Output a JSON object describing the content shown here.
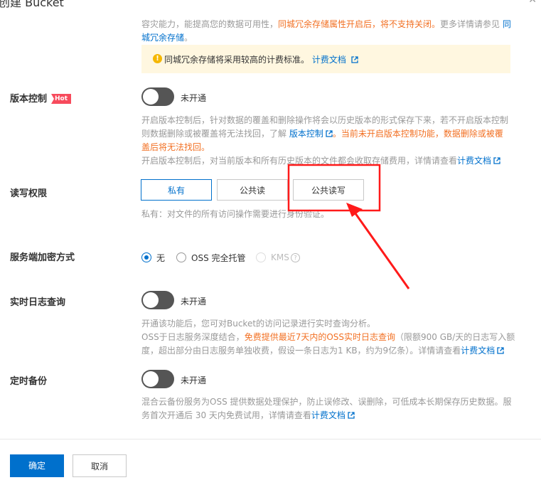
{
  "dialog": {
    "title": "创建 Bucket",
    "close_icon": "close-icon"
  },
  "redundancy": {
    "desc_line1_gray": "容灾能力，能提高您的数据可用性，",
    "desc_line1_orange": "同城冗余存储属性开启后，将不支持关闭。",
    "desc_line1_gray2": "更多详情请参见",
    "desc_line1_link": "同",
    "desc_line2_link": "城冗余存储",
    "desc_line2_end": "。",
    "warning_text": "同城冗余存储将采用较高的计费标准。",
    "warning_link": "计费文档"
  },
  "versioning": {
    "label": "版本控制",
    "hot_badge": "Hot",
    "toggle_text": "未开通",
    "desc1": "开启版本控制后，针对数据的覆盖和删除操作将会以历史版本的形式保存下来，若不开启版本控制",
    "desc2_gray": "则数据删除或被覆盖将无法找回，了解",
    "desc2_link": "版本控制",
    "desc2_orange": "。当前未开启版本控制功能，数据删除或被覆",
    "desc3_orange": "盖后将无法找回。",
    "desc4_gray": "开启版本控制后，对当前版本和所有历史版本的文件都会收取存储费用，详情请查看",
    "desc4_link": "计费文档"
  },
  "acl": {
    "label": "读写权限",
    "options": [
      "私有",
      "公共读",
      "公共读写"
    ],
    "selected": "私有",
    "desc": "私有：对文件的所有访问操作需要进行身份验证。"
  },
  "encryption": {
    "label": "服务端加密方式",
    "options": [
      "无",
      "OSS 完全托管",
      "KMS"
    ],
    "selected": "无"
  },
  "realtime_log": {
    "label": "实时日志查询",
    "toggle_text": "未开通",
    "desc1": "开通该功能后，您可对Bucket的访问记录进行实时查询分析。",
    "desc2_gray": "OSS于日志服务深度结合，",
    "desc2_orange": "免费提供最近7天内的OSS实时日志查询",
    "desc2_gray2": "（限额900 GB/天的日志写入额",
    "desc3_gray": "度，超出部分由日志服务单独收费，假设一条日志为1 KB，约为9亿条）。详情请查看",
    "desc3_link": "计费文档"
  },
  "backup": {
    "label": "定时备份",
    "toggle_text": "未开通",
    "desc1": "混合云备份服务为OSS 提供数据处理保护，防止误修改、误删除，可低成本长期保存历史数据。服",
    "desc2_gray": "务首次开通后 30 天内免费试用，详情请查看",
    "desc2_link": "计费文档"
  },
  "footer": {
    "confirm": "确定",
    "cancel": "取消"
  },
  "colors": {
    "primary": "#0070cc",
    "warning_orange": "#f27023",
    "annotation_red": "#ff1a1a"
  }
}
